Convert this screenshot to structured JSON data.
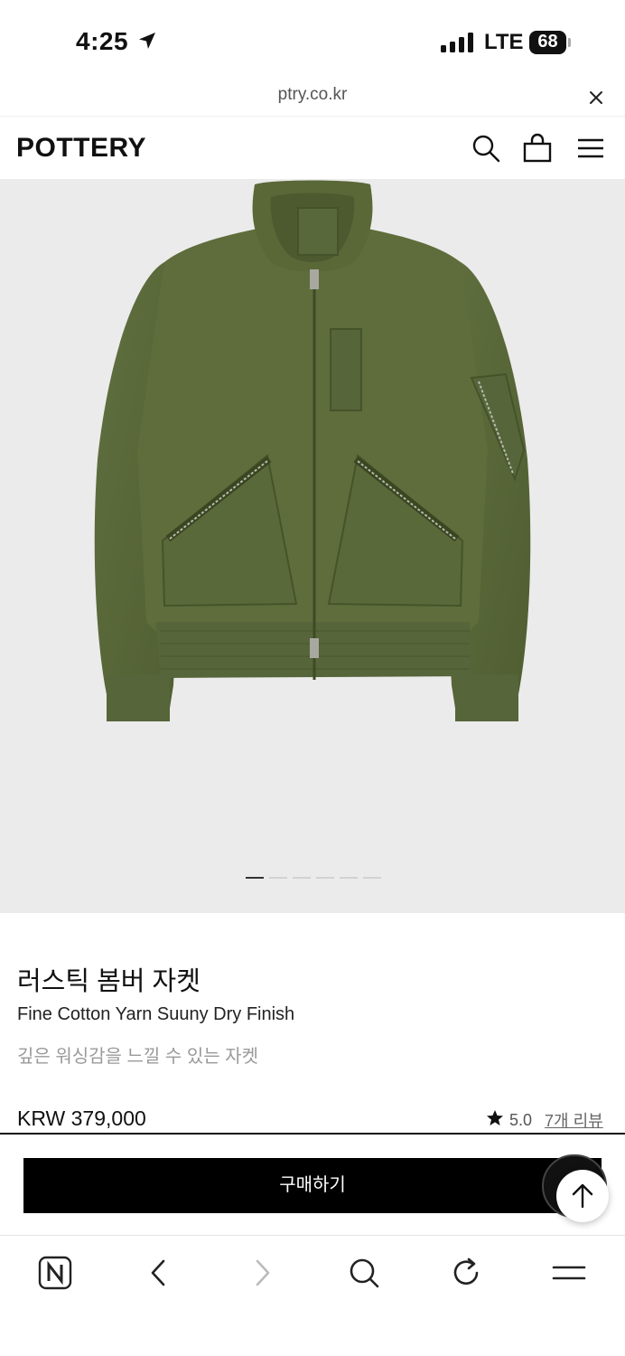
{
  "status_bar": {
    "time": "4:25",
    "network": "LTE",
    "battery": "68",
    "icons": [
      "location-arrow-icon",
      "signal-bars-icon",
      "battery-icon"
    ]
  },
  "browser": {
    "url": "ptry.co.kr",
    "close_icon": "close-icon",
    "bottom_icons": [
      "naver-n-icon",
      "back-chevron-icon",
      "forward-chevron-icon",
      "search-icon",
      "reload-icon",
      "menu-icon"
    ]
  },
  "header": {
    "logo": "POTTERY",
    "icons": [
      "search-icon",
      "shopping-bag-icon",
      "hamburger-menu-icon"
    ]
  },
  "gallery": {
    "image": "olive-green-bomber-jacket",
    "slide_count": 6,
    "active_index": 0
  },
  "product": {
    "name": "러스틱 봄버 자켓",
    "subtitle": "Fine Cotton Yarn Suuny Dry Finish",
    "description": "깊은 워싱감을 느낄 수 있는 자켓",
    "price": "KRW 379,000",
    "rating": "5.0",
    "reviews": "7개 리뷰"
  },
  "actions": {
    "buy": "구매하기",
    "scroll_top_icon": "arrow-up-icon"
  },
  "colors": {
    "primary": "#000000",
    "hero_bg": "#ebebeb",
    "jacket": "#5b6a3a"
  }
}
